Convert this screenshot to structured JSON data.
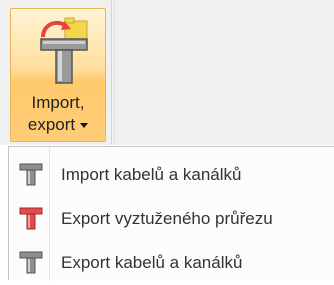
{
  "ribbon": {
    "import_export_button": {
      "line1": "Import,",
      "line2": "export",
      "icon": "t-beam-import-export-icon"
    }
  },
  "dropdown": {
    "items": [
      {
        "label": "Import kabelů a kanálků",
        "icon": "t-beam-gray-icon",
        "color": "#6b6b6b"
      },
      {
        "label": "Export vyztuženého průřezu",
        "icon": "t-beam-red-icon",
        "color": "#d94040"
      },
      {
        "label": "Export kabelů a kanálků",
        "icon": "t-beam-gray-icon",
        "color": "#6b6b6b"
      }
    ]
  },
  "colors": {
    "button_highlight": "#ffd98a",
    "button_border": "#e7b45a",
    "arrow_red": "#e2453a",
    "folder_yellow": "#f2d64b"
  }
}
